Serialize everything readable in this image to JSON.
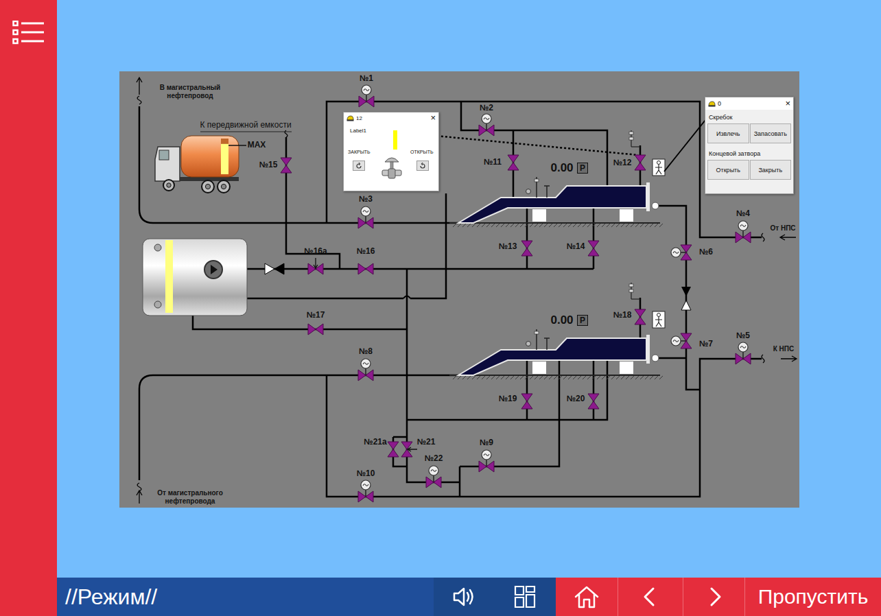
{
  "bottom_bar": {
    "mode": "//Режим//",
    "skip": "Пропустить"
  },
  "diagram": {
    "flow_labels": {
      "to_main": "В магистральный\nнефтепровод",
      "from_main": "От магистрального\nнефтепровода",
      "to_mobile_tank": "К передвижной емкости",
      "from_nps": "От НПС",
      "to_nps": "К НПС"
    },
    "truck": {
      "tank_label": "MAX",
      "level": 0.85
    },
    "storage_tank": {
      "level": 1
    },
    "launchers": [
      {
        "pressure": "0.00",
        "pressure_badge": "P"
      },
      {
        "pressure": "0.00",
        "pressure_badge": "P"
      }
    ],
    "valves": [
      {
        "label": "№1",
        "kind": "motor"
      },
      {
        "label": "№2",
        "kind": "motor"
      },
      {
        "label": "№3",
        "kind": "motor"
      },
      {
        "label": "№4",
        "kind": "motor"
      },
      {
        "label": "№5",
        "kind": "motor"
      },
      {
        "label": "№6",
        "kind": "motor"
      },
      {
        "label": "№7",
        "kind": "motor"
      },
      {
        "label": "№8",
        "kind": "motor"
      },
      {
        "label": "№9",
        "kind": "motor"
      },
      {
        "label": "№10",
        "kind": "motor"
      },
      {
        "label": "№11",
        "kind": "manual"
      },
      {
        "label": "№12",
        "kind": "manual"
      },
      {
        "label": "№13",
        "kind": "manual"
      },
      {
        "label": "№14",
        "kind": "manual"
      },
      {
        "label": "№15",
        "kind": "manual"
      },
      {
        "label": "№16",
        "kind": "manual"
      },
      {
        "label": "№16a",
        "kind": "regulating"
      },
      {
        "label": "№17",
        "kind": "manual"
      },
      {
        "label": "№18",
        "kind": "manual"
      },
      {
        "label": "№19",
        "kind": "manual"
      },
      {
        "label": "№20",
        "kind": "manual"
      },
      {
        "label": "№21a",
        "kind": "manual"
      },
      {
        "label": "№21",
        "kind": "regulating"
      },
      {
        "label": "№22",
        "kind": "motor"
      }
    ]
  },
  "valve_window": {
    "title": "12",
    "close": "×",
    "label": "Label1",
    "close_label": "ЗАКРЫТЬ",
    "open_label": "ОТКРЫТЬ",
    "level": 1
  },
  "scraper_window": {
    "title": "0",
    "close": "×",
    "sections": [
      {
        "title": "Скребок",
        "buttons": [
          "Извлечь",
          "Запасовать"
        ]
      },
      {
        "title": "Концевой затвора",
        "buttons": [
          "Открыть",
          "Закрыть"
        ]
      }
    ]
  }
}
